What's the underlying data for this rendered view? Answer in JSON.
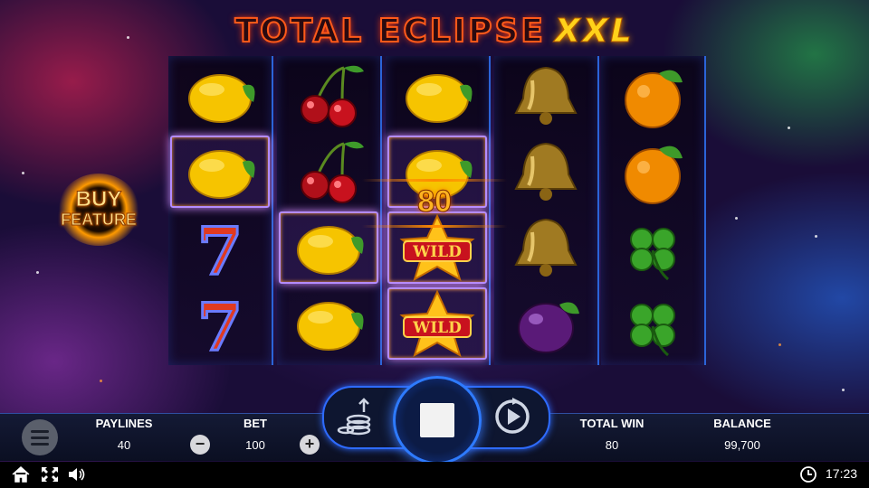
{
  "title": {
    "part1": "TOTAL ECLIPSE",
    "part2": "XXL"
  },
  "buy_feature": {
    "line1": "BUY",
    "line2": "FEATURE"
  },
  "win_amount": "80",
  "reels": [
    [
      "lemon",
      "lemon",
      "seven",
      "seven"
    ],
    [
      "cherry",
      "cherry",
      "lemon",
      "lemon"
    ],
    [
      "lemon",
      "lemon",
      "wild",
      "wild"
    ],
    [
      "bell",
      "bell",
      "bell",
      "plum"
    ],
    [
      "orange",
      "orange",
      "clover",
      "clover"
    ]
  ],
  "wild_label": "WILD",
  "highlighted_cells": [
    "0-1",
    "1-2",
    "2-1",
    "2-2",
    "2-3"
  ],
  "bottom": {
    "paylines_label": "PAYLINES",
    "paylines_value": "40",
    "bet_label": "BET",
    "bet_value": "100",
    "minus_label": "−",
    "plus_label": "+",
    "total_win_label": "TOTAL WIN",
    "total_win_value": "80",
    "balance_label": "BALANCE",
    "balance_value": "99,700"
  },
  "system": {
    "time": "17:23"
  },
  "icons": [
    "home-icon",
    "fullscreen-icon",
    "sound-icon",
    "clock-icon",
    "menu-icon",
    "coins-bet-icon",
    "autoplay-icon",
    "stop-icon"
  ],
  "colors": {
    "reel_border": "#2b64d8",
    "highlight": "#b48cff",
    "win_text": "#ffb321",
    "title_accent": "#ffd21a"
  }
}
